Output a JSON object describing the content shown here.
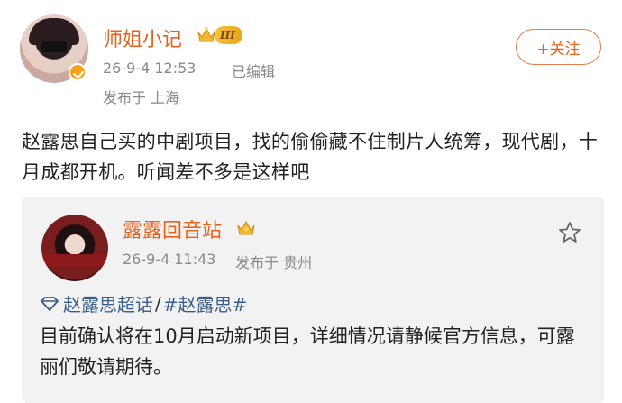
{
  "post": {
    "author": "师姐小记",
    "level_badge": "III",
    "time": "26-9-4 12:53",
    "edited": "已编辑",
    "location": "发布于 上海",
    "follow_label": "+关注",
    "text": "赵露思自己买的中剧项目，找的偷偷藏不住制片人统筹，现代剧，十月成都开机。听闻差不多是这样吧"
  },
  "repost": {
    "author": "露露回音站",
    "time": "26-9-4 11:43",
    "location": "发布于 贵州",
    "topic": "赵露思超话",
    "separator": "/",
    "hashtag": "#赵露思#",
    "text": "目前确认将在10月启动新项目，详细情况请静候官方信息，可露丽们敬请期待。"
  },
  "colors": {
    "accent": "#e8621b",
    "link": "#3a5e8c",
    "meta": "#8a8a8a"
  }
}
